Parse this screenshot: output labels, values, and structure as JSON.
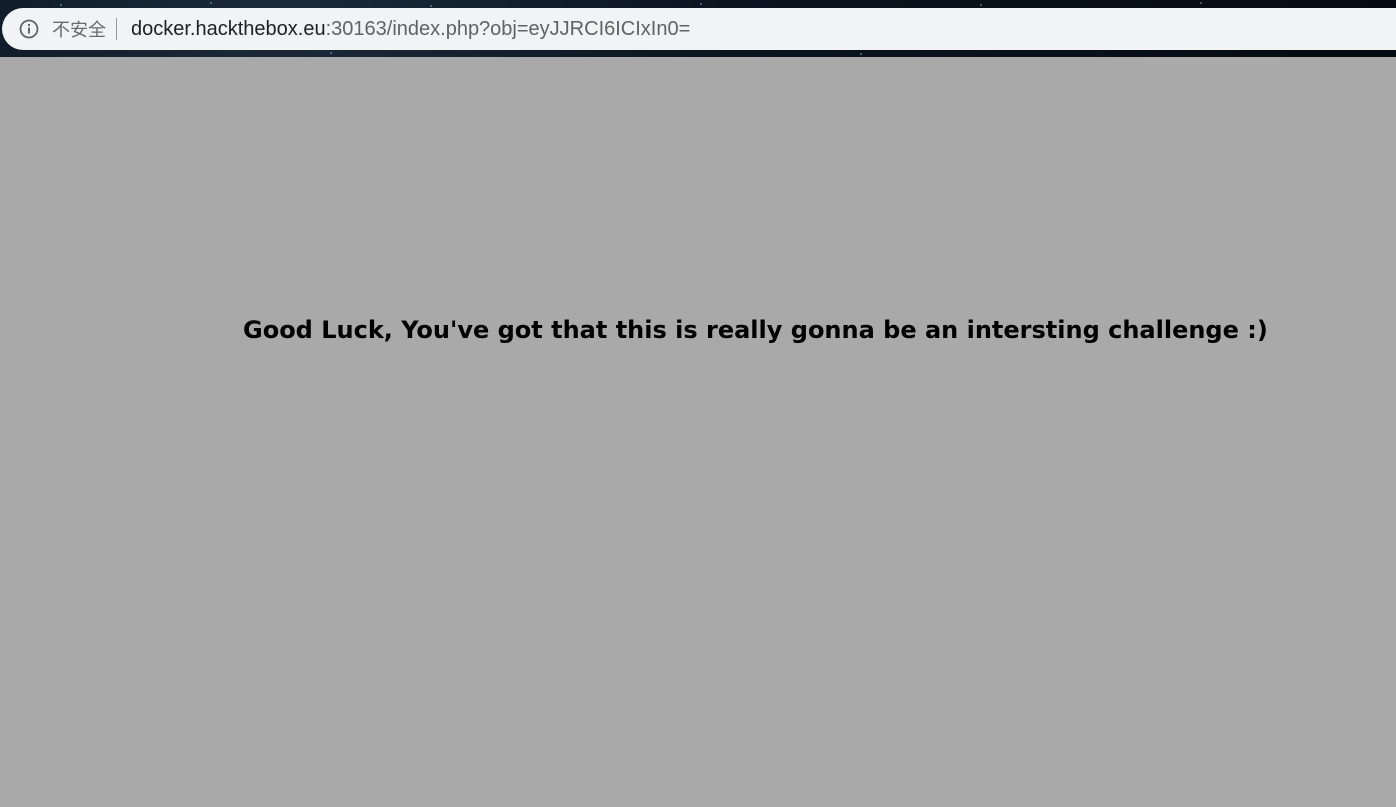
{
  "browser": {
    "security_label": "不安全",
    "url_host": "docker.hackthebox.eu",
    "url_rest": ":30163/index.php?obj=eyJJRCI6ICIxIn0="
  },
  "page": {
    "message": "Good Luck, You've got that this is really gonna be an intersting challenge :)",
    "background_color": "#a9a9a9",
    "text_color": "#000000"
  },
  "icons": {
    "security": "info-circle-icon"
  }
}
